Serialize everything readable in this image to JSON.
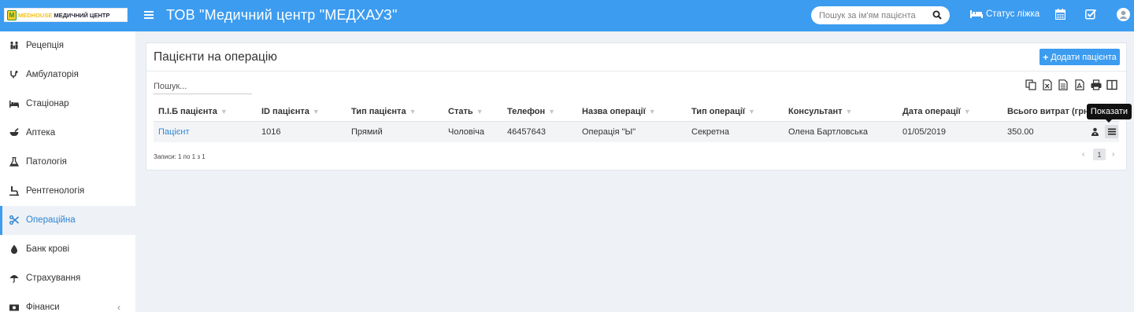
{
  "header": {
    "logo_brand": "MEDHOUSE",
    "logo_sub": "МЕДИЧНИЙ ЦЕНТР",
    "logo_mark": "M",
    "title": "ТОВ \"Медичний центр \"МЕДХАУЗ\"",
    "search_placeholder": "Пошук за ім'ям пацієнта",
    "bed_status": "Статус ліжка"
  },
  "sidebar": {
    "items": [
      {
        "label": "Рецепція",
        "icon": "people-icon"
      },
      {
        "label": "Амбулаторія",
        "icon": "stethoscope-icon"
      },
      {
        "label": "Стаціонар",
        "icon": "bed-icon"
      },
      {
        "label": "Аптека",
        "icon": "mortar-icon"
      },
      {
        "label": "Патологія",
        "icon": "flask-icon"
      },
      {
        "label": "Рентгенологія",
        "icon": "xray-icon"
      },
      {
        "label": "Операційна",
        "icon": "scissors-icon",
        "active": true
      },
      {
        "label": "Банк крові",
        "icon": "drop-icon"
      },
      {
        "label": "Страхування",
        "icon": "umbrella-icon"
      },
      {
        "label": "Фінанси",
        "icon": "money-icon",
        "chevron": "‹"
      }
    ]
  },
  "panel": {
    "title": "Пацієнти на операцію",
    "add_button": "Додати пацієнта",
    "filter_placeholder": "Пошук...",
    "records_info": "Записи: 1 по 1 з 1",
    "tooltip": "Показати",
    "pager": {
      "prev": "‹",
      "page": "1",
      "next": "›"
    }
  },
  "table": {
    "columns": [
      "П.І.Б пацієнта",
      "ID пацієнта",
      "Тип пацієнта",
      "Стать",
      "Телефон",
      "Назва операції",
      "Тип операції",
      "Консультант",
      "Дата операції",
      "Всього витрат (грн)"
    ],
    "rows": [
      {
        "name": "Пацієнт",
        "id": "1016",
        "type": "Прямий",
        "gender": "Чоловіча",
        "phone": "46457643",
        "operation": "Операція \"Ы\"",
        "op_type": "Секретна",
        "consultant": "Олена Бартловська",
        "date": "01/05/2019",
        "total": "350.00"
      }
    ]
  },
  "colors": {
    "topbar": "#3c9cf0",
    "accent": "#3c9cf0",
    "link": "#2d86d6",
    "background": "#eef1f5"
  }
}
